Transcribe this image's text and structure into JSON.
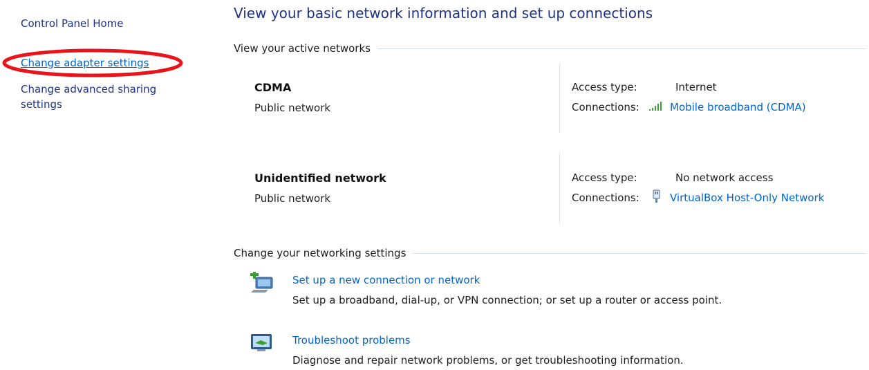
{
  "sidebar": {
    "home_label": "Control Panel Home",
    "adapter_label": "Change adapter settings",
    "advanced_label": "Change advanced sharing settings"
  },
  "main": {
    "title": "View your basic network information and set up connections",
    "active_networks_header": "View your active networks",
    "networks": [
      {
        "name": "CDMA",
        "type": "Public network",
        "access_label": "Access type:",
        "access_value": "Internet",
        "connections_label": "Connections:",
        "connection_name": "Mobile broadband (CDMA)",
        "connection_icon": "signal-bars-icon"
      },
      {
        "name": "Unidentified network",
        "type": "Public network",
        "access_label": "Access type:",
        "access_value": "No network access",
        "connections_label": "Connections:",
        "connection_name": "VirtualBox Host-Only Network",
        "connection_icon": "ethernet-plug-icon"
      }
    ],
    "change_settings_header": "Change your networking settings",
    "tasks": [
      {
        "link": "Set up a new connection or network",
        "description": "Set up a broadband, dial-up, or VPN connection; or set up a router or access point.",
        "icon": "new-connection-icon"
      },
      {
        "link": "Troubleshoot problems",
        "description": "Diagnose and repair network problems, or get troubleshooting information.",
        "icon": "troubleshoot-icon"
      }
    ]
  },
  "colors": {
    "link": "#0066cc",
    "title": "#1e3287",
    "highlight": "#e8141c",
    "divider": "#d5dfe5"
  }
}
